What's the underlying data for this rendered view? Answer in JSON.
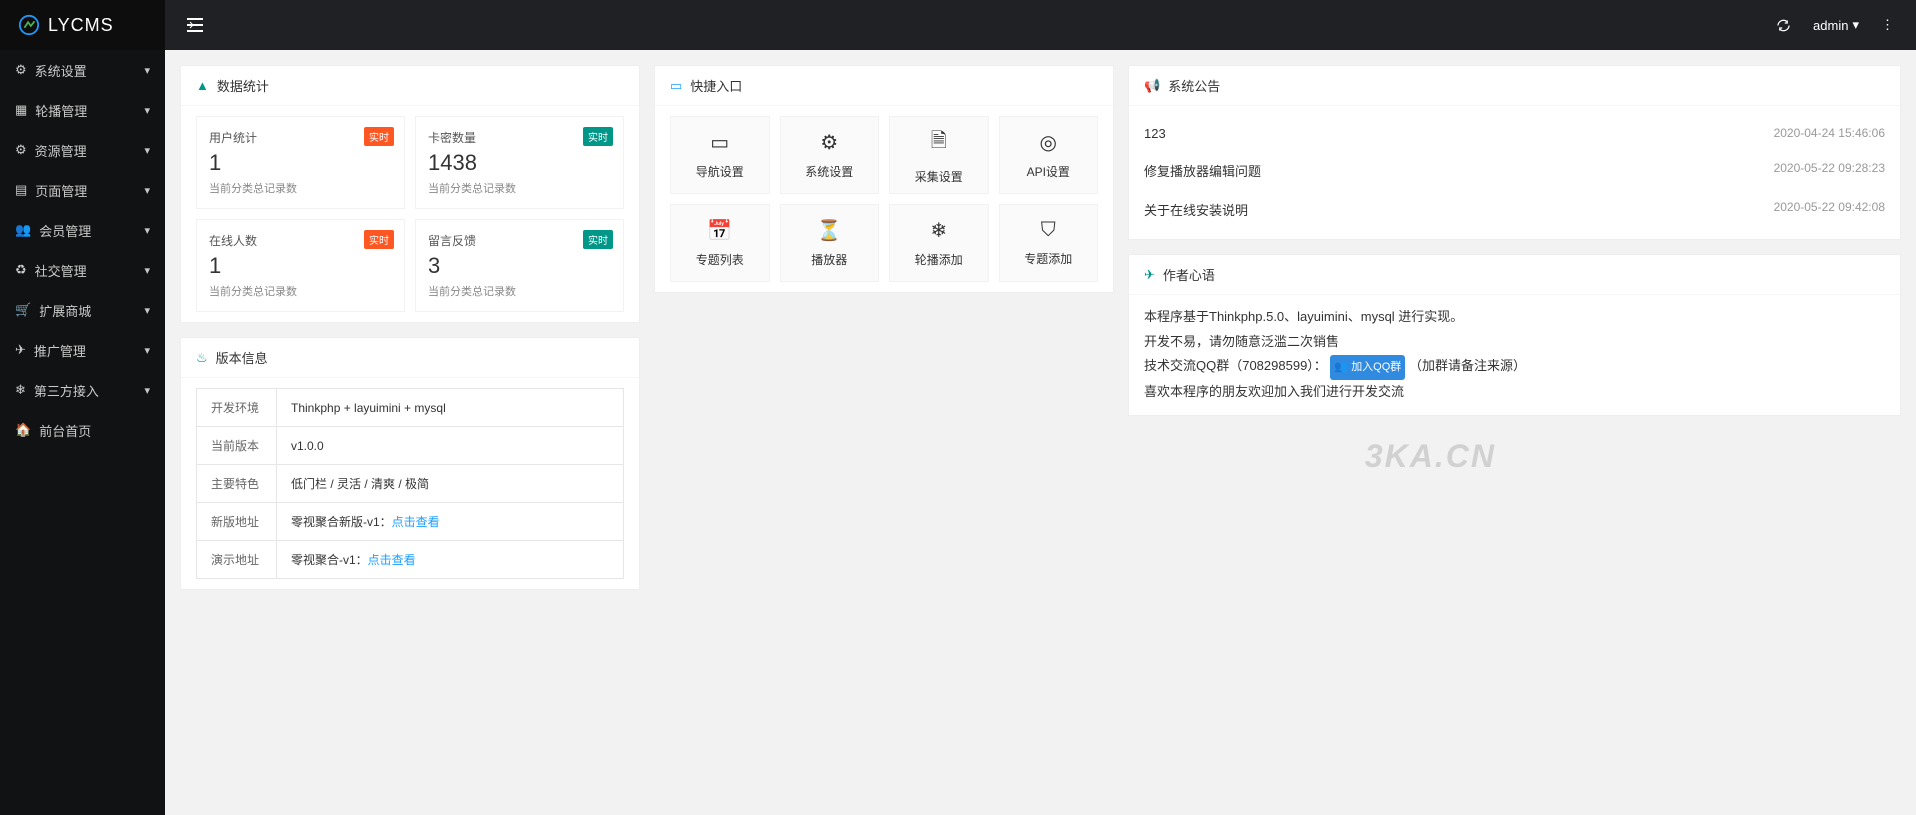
{
  "brand": "LYCMS",
  "header": {
    "user": "admin"
  },
  "sidebar": {
    "items": [
      {
        "label": "系统设置",
        "icon": "gear"
      },
      {
        "label": "轮播管理",
        "icon": "images"
      },
      {
        "label": "资源管理",
        "icon": "cogs"
      },
      {
        "label": "页面管理",
        "icon": "windows"
      },
      {
        "label": "会员管理",
        "icon": "users"
      },
      {
        "label": "社交管理",
        "icon": "recycle"
      },
      {
        "label": "扩展商城",
        "icon": "cart"
      },
      {
        "label": "推广管理",
        "icon": "send"
      },
      {
        "label": "第三方接入",
        "icon": "asterisk"
      }
    ],
    "home": {
      "label": "前台首页"
    }
  },
  "stats": {
    "title": "数据统计",
    "items": [
      {
        "title": "用户统计",
        "value": "1",
        "sub": "当前分类总记录数",
        "badge": "实时",
        "badge_color": "red"
      },
      {
        "title": "卡密数量",
        "value": "1438",
        "sub": "当前分类总记录数",
        "badge": "实时",
        "badge_color": "green"
      },
      {
        "title": "在线人数",
        "value": "1",
        "sub": "当前分类总记录数",
        "badge": "实时",
        "badge_color": "red"
      },
      {
        "title": "留言反馈",
        "value": "3",
        "sub": "当前分类总记录数",
        "badge": "实时",
        "badge_color": "green"
      }
    ]
  },
  "quick": {
    "title": "快捷入口",
    "items": [
      {
        "label": "导航设置"
      },
      {
        "label": "系统设置"
      },
      {
        "label": "采集设置"
      },
      {
        "label": "API设置"
      },
      {
        "label": "专题列表"
      },
      {
        "label": "播放器"
      },
      {
        "label": "轮播添加"
      },
      {
        "label": "专题添加"
      }
    ]
  },
  "notice": {
    "title": "系统公告",
    "items": [
      {
        "text": "123",
        "time": "2020-04-24 15:46:06"
      },
      {
        "text": "修复播放器编辑问题",
        "time": "2020-05-22 09:28:23"
      },
      {
        "text": "关于在线安装说明",
        "time": "2020-05-22 09:42:08"
      }
    ]
  },
  "version": {
    "title": "版本信息",
    "rows": [
      {
        "label": "开发环境",
        "value": "Thinkphp + layuimini + mysql"
      },
      {
        "label": "当前版本",
        "value": "v1.0.0"
      },
      {
        "label": "主要特色",
        "value": "低门栏 / 灵活 / 清爽 / 极简"
      },
      {
        "label": "新版地址",
        "prefix": "零视聚合新版-v1：",
        "link": "点击查看"
      },
      {
        "label": "演示地址",
        "prefix": "零视聚合-v1：",
        "link": "点击查看"
      }
    ]
  },
  "author": {
    "title": "作者心语",
    "lines": [
      "本程序基于Thinkphp.5.0、layuimini、mysql 进行实现。",
      "开发不易，请勿随意泛滥二次销售"
    ],
    "qq_prefix": "技术交流QQ群（708298599）：",
    "qq_badge": "加入QQ群",
    "qq_suffix": "（加群请备注来源）",
    "line4": "喜欢本程序的朋友欢迎加入我们进行开发交流"
  },
  "watermark": "3KA.CN"
}
